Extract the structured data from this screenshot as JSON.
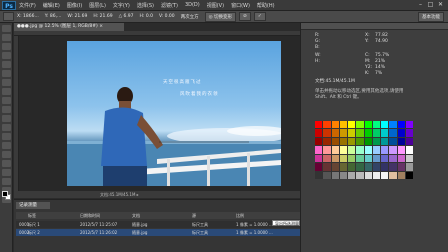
{
  "menu": {
    "logo": "Ps",
    "items": [
      "文件(F)",
      "编辑(E)",
      "图像(I)",
      "图层(L)",
      "文字(Y)",
      "选择(S)",
      "滤镜(T)",
      "3D(D)",
      "视图(V)",
      "窗口(W)",
      "帮助(H)"
    ],
    "minimize": "–",
    "maximize": "□",
    "close": "✕"
  },
  "options": {
    "x": "X: 1866...",
    "y": "Y: 86,...",
    "w": "W: 21.69",
    "h": "H: 21.69",
    "angle": "△ 6.97",
    "h_skew": "H: 0.0",
    "v_skew": "V: 0.00",
    "interp": "两次立方",
    "mode_button": "◎ 切换变形",
    "cancel_button": "⊘",
    "commit_button": "✓",
    "workspace": "基本功能"
  },
  "document": {
    "tab_title": "●●●.jpg @ 12.5% (图层 1, RGB/8#) × ",
    "poem_line1": "天空很高雁飞过",
    "poem_line2": "风吹着我的衣领",
    "status": "文档:45.1M/45.1M ▸"
  },
  "right_panel": {
    "info": [
      {
        "label": "R:",
        "value": ""
      },
      {
        "label": "G:",
        "value": ""
      },
      {
        "label": "B:",
        "value": ""
      },
      {
        "label": "X:",
        "value": "77.82"
      },
      {
        "label": "Y:",
        "value": "74.90"
      },
      {
        "label": "W:",
        "value": ""
      },
      {
        "label": "H:",
        "value": ""
      },
      {
        "label": "C:",
        "value": "75.7%"
      },
      {
        "label": "M:",
        "value": "21%"
      },
      {
        "label": "Y2:",
        "value": "14%"
      },
      {
        "label": "K:",
        "value": "7%"
      }
    ],
    "doc_info": "文档:45.1M/45.1M",
    "hint": "单击并拖动以移动选区,要用其他选项,请使用 Shift、Alt 和 Ctrl 键。"
  },
  "palette_colors": [
    "#ff0000",
    "#ff4000",
    "#ff8000",
    "#ffbf00",
    "#ffff00",
    "#80ff00",
    "#00ff00",
    "#00ff80",
    "#00ffff",
    "#0080ff",
    "#0000ff",
    "#8000ff",
    "#cc0000",
    "#cc3300",
    "#cc6600",
    "#cc9900",
    "#cccc00",
    "#66cc00",
    "#00cc00",
    "#00cc66",
    "#00cccc",
    "#0066cc",
    "#0000cc",
    "#6600cc",
    "#990000",
    "#992600",
    "#994d00",
    "#997300",
    "#999900",
    "#4d9900",
    "#009900",
    "#00994d",
    "#009999",
    "#004d99",
    "#000099",
    "#4d0099",
    "#ff66cc",
    "#ff9999",
    "#ffcc99",
    "#ffff99",
    "#ccff99",
    "#99ffcc",
    "#99ffff",
    "#99ccff",
    "#9999ff",
    "#cc99ff",
    "#ff99ff",
    "#ffffff",
    "#cc3399",
    "#cc6666",
    "#cc9966",
    "#cccc66",
    "#99cc66",
    "#66cc99",
    "#66cccc",
    "#6699cc",
    "#6666cc",
    "#9966cc",
    "#cc66cc",
    "#cccccc",
    "#660033",
    "#663333",
    "#664433",
    "#666633",
    "#446633",
    "#336644",
    "#336666",
    "#334466",
    "#333366",
    "#443366",
    "#663366",
    "#999999",
    "#333333",
    "#555555",
    "#777777",
    "#888888",
    "#aaaaaa",
    "#bbbbbb",
    "#dddddd",
    "#eeeeee",
    "#f5f5f5",
    "#e0c0a0",
    "#a08060",
    "#000000"
  ],
  "bottom_panel": {
    "tab": "记录测量",
    "headers": [
      "",
      "标签",
      "日期和时间",
      "文档",
      "源",
      "比例"
    ],
    "rows": [
      [
        "0001",
        "标尺 1",
        "2012/5/7 11:25:07",
        "随意.jpg",
        "标尺工具",
        "1 像素 = 1.0000 ..."
      ],
      [
        "0002",
        "标尺 2",
        "2012/5/7 11:26:02",
        "随意.jpg",
        "标尺工具",
        "1 像素 = 1.0000 ..."
      ]
    ],
    "tooltip": "导出所选测量"
  }
}
